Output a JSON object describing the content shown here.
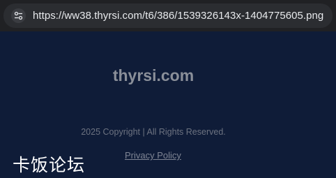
{
  "browser": {
    "url": "https://ww38.thyrsi.com/t6/386/1539326143x-1404775605.png",
    "site_info_icon": "tune-icon"
  },
  "page": {
    "logo": "thyrsi.com",
    "copyright": "2025 Copyright | All Rights Reserved.",
    "privacy_link": "Privacy Policy"
  },
  "watermark": {
    "text": "卡饭论坛"
  },
  "colors": {
    "page_background": "#0f1c38",
    "browser_bar": "#202124"
  }
}
